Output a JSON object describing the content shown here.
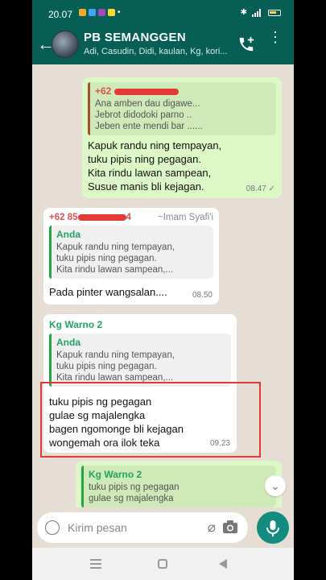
{
  "status": {
    "time": "20.07",
    "dot": "•"
  },
  "header": {
    "title": "PB SEMANGGEN",
    "subtitle": "Adi, Casudin, Didi, kaulan, Kg, kori..."
  },
  "messages": [
    {
      "type": "outgoing",
      "quote_sender": "+62",
      "quote_lines": [
        "Ana amben dau digawe...",
        "Jebrot didodoki parno ..",
        "Jeben ente mendi bar ......"
      ],
      "text": [
        "Kapuk randu ning tempayan,",
        "tuku pipis ning pegagan.",
        "Kita rindu lawan sampean,",
        "Susue manis bli kejagan."
      ],
      "time": "08.47",
      "ticks": "✓"
    },
    {
      "type": "incoming",
      "sender_prefix": "+62 85",
      "sender_suffix": "4",
      "sender_name": "~Imam Syafi'i",
      "quote_sender": "Anda",
      "quote_lines": [
        "Kapuk randu ning tempayan,",
        "tuku pipis ning pegagan.",
        "Kita rindu lawan sampean,..."
      ],
      "text": [
        "Pada pinter wangsalan...."
      ],
      "time": "08.50"
    },
    {
      "type": "incoming",
      "sender_name": "Kg Warno 2",
      "quote_sender": "Anda",
      "quote_lines": [
        "Kapuk randu ning tempayan,",
        "tuku pipis ning pegagan.",
        "Kita rindu lawan sampean,..."
      ],
      "text": [
        "tuku pipis ng pegagan",
        "gulae sg majalengka",
        "bagen ngomonge bli kejagan",
        "wongemah ora ilok teka"
      ],
      "time": "09.23"
    },
    {
      "type": "outgoing",
      "quote_sender": "Kg Warno 2",
      "quote_lines": [
        "tuku pipis ng pegagan",
        "gulae sg majalengka"
      ]
    }
  ],
  "input": {
    "placeholder": "Kirim pesan"
  },
  "colors": {
    "header": "#075e54",
    "outgoing": "#dcf8c6",
    "accent": "#128c7e",
    "highlight_box": "#e53935"
  }
}
